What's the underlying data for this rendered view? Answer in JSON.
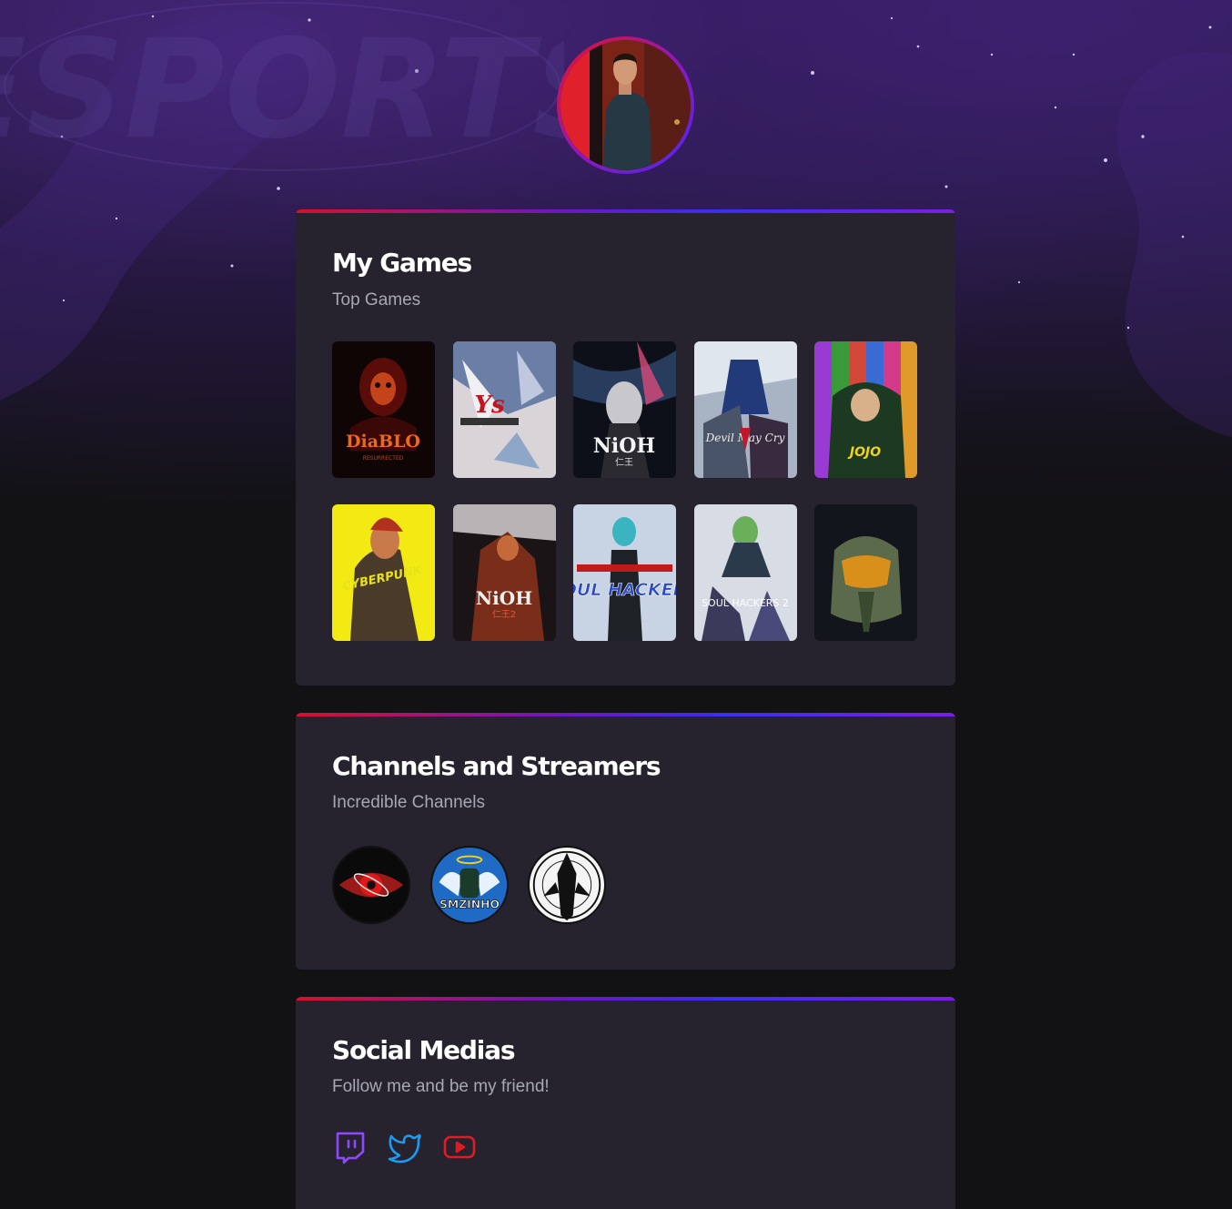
{
  "profile": {
    "avatar_alt": "profile photo",
    "watermark_text": "ESPORTS"
  },
  "games_section": {
    "title": "My Games",
    "subtitle": "Top Games",
    "games": [
      {
        "name": "Diablo II Resurrected",
        "icon": "diablo-2-cover"
      },
      {
        "name": "Ys IX Monstrum Nox",
        "icon": "ys-cover"
      },
      {
        "name": "Nioh",
        "icon": "nioh-cover"
      },
      {
        "name": "Devil May Cry 5",
        "icon": "devil-may-cry-5-cover"
      },
      {
        "name": "JoJo's Bizarre Adventure",
        "icon": "jojo-cover"
      },
      {
        "name": "Cyberpunk",
        "icon": "cyberpunk-cover"
      },
      {
        "name": "Nioh 2",
        "icon": "nioh-2-cover"
      },
      {
        "name": "Soul Hackers",
        "icon": "soul-hackers-cover"
      },
      {
        "name": "Soul Hackers 2",
        "icon": "soul-hackers-2-cover"
      },
      {
        "name": "Halo",
        "icon": "halo-cover"
      }
    ]
  },
  "channels_section": {
    "title": "Channels and Streamers",
    "subtitle": "Incredible Channels",
    "channels": [
      {
        "name": "red-eye-channel",
        "icon": "red-eye-icon"
      },
      {
        "name": "SMZINHO",
        "icon": "smzinho-icon"
      },
      {
        "name": "rune-crest-channel",
        "icon": "rune-crest-icon"
      }
    ]
  },
  "social_section": {
    "title": "Social Medias",
    "subtitle": "Follow me and be my friend!",
    "links": [
      {
        "name": "twitch",
        "icon": "twitch-icon",
        "color": "#9147ff"
      },
      {
        "name": "twitter",
        "icon": "twitter-icon",
        "color": "#1d9bf0"
      },
      {
        "name": "youtube",
        "icon": "youtube-icon",
        "color": "#e01b22"
      }
    ]
  },
  "colors": {
    "background": "#121214",
    "card": "#26232f",
    "accent_start": "#d8102c",
    "accent_end": "#3b2df2",
    "subtitle": "#a8a8b3"
  }
}
